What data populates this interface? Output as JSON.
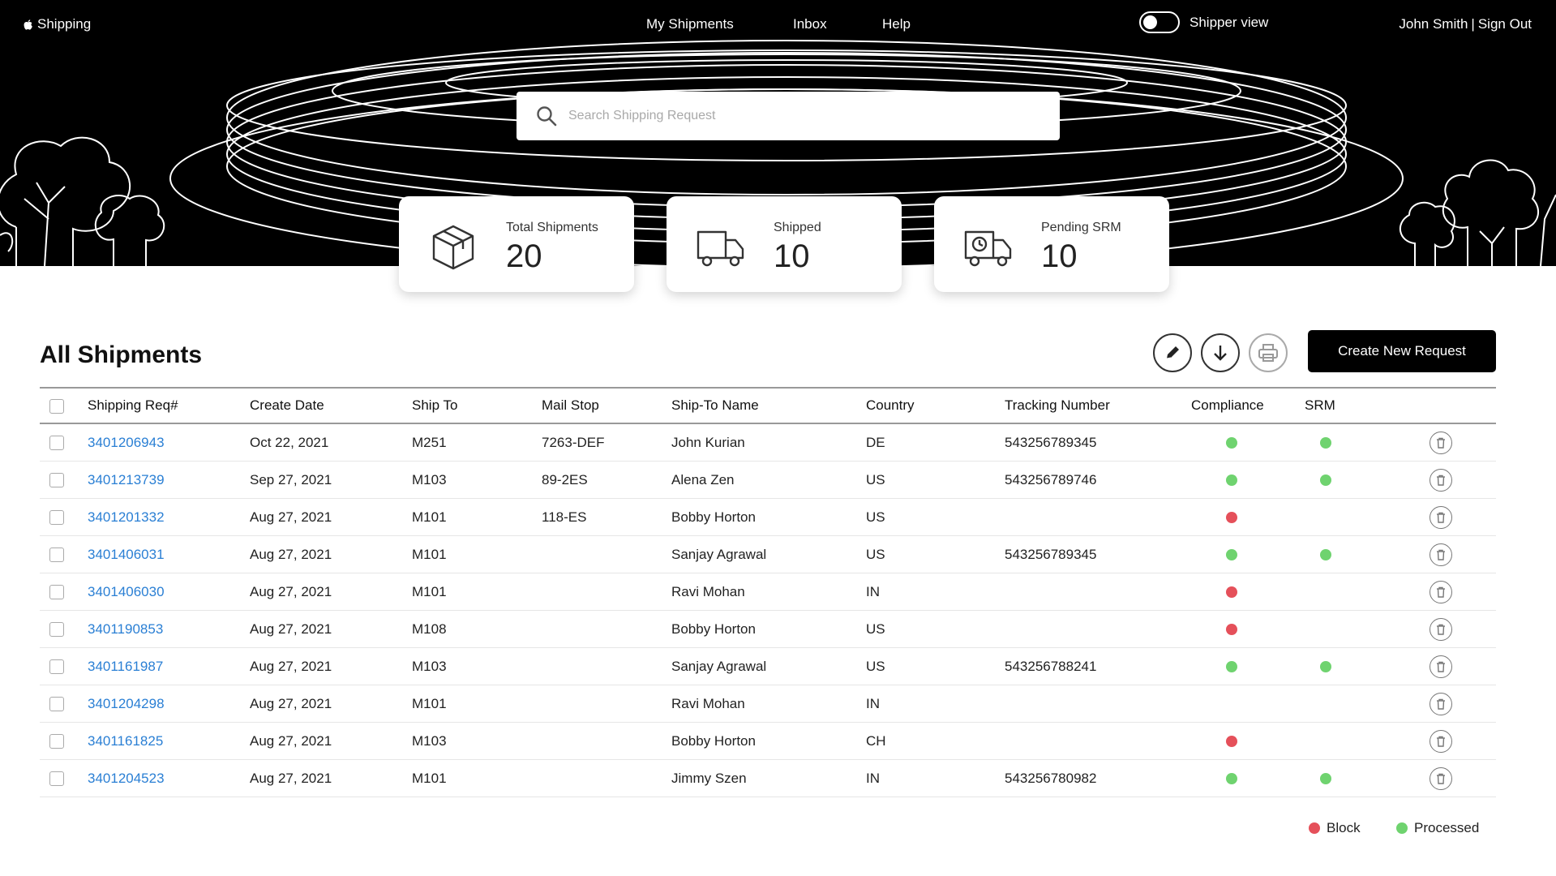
{
  "app": {
    "name": "Shipping"
  },
  "nav": {
    "items": [
      "My Shipments",
      "Inbox",
      "Help"
    ]
  },
  "toggle": {
    "label": "Shipper view",
    "on": false
  },
  "user": {
    "name": "John Smith",
    "separator": "|",
    "sign_out": "Sign Out"
  },
  "search": {
    "placeholder": "Search Shipping Request",
    "value": ""
  },
  "stats": [
    {
      "label": "Total Shipments",
      "value": "20",
      "icon": "package-icon"
    },
    {
      "label": "Shipped",
      "value": "10",
      "icon": "truck-icon"
    },
    {
      "label": "Pending SRM",
      "value": "10",
      "icon": "truck-clock-icon"
    }
  ],
  "section": {
    "title": "All Shipments"
  },
  "toolbar": {
    "edit_icon": "pencil-icon",
    "download_icon": "download-icon",
    "print_icon": "printer-icon",
    "create_label": "Create New Request"
  },
  "table": {
    "columns": [
      "Shipping Req#",
      "Create Date",
      "Ship To",
      "Mail Stop",
      "Ship-To Name",
      "Country",
      "Tracking Number",
      "Compliance",
      "SRM"
    ],
    "rows": [
      {
        "req": "3401206943",
        "date": "Oct 22, 2021",
        "ship_to": "M251",
        "mail_stop": "7263-DEF",
        "name": "John Kurian",
        "country": "DE",
        "tracking": "543256789345",
        "compliance": "processed",
        "srm": "processed"
      },
      {
        "req": "3401213739",
        "date": "Sep 27, 2021",
        "ship_to": "M103",
        "mail_stop": "89-2ES",
        "name": "Alena Zen",
        "country": "US",
        "tracking": "543256789746",
        "compliance": "processed",
        "srm": "processed"
      },
      {
        "req": "3401201332",
        "date": "Aug 27, 2021",
        "ship_to": "M101",
        "mail_stop": "118-ES",
        "name": "Bobby Horton",
        "country": "US",
        "tracking": "",
        "compliance": "block",
        "srm": ""
      },
      {
        "req": "3401406031",
        "date": "Aug 27, 2021",
        "ship_to": "M101",
        "mail_stop": "",
        "name": "Sanjay Agrawal",
        "country": "US",
        "tracking": "543256789345",
        "compliance": "processed",
        "srm": "processed"
      },
      {
        "req": "3401406030",
        "date": "Aug 27, 2021",
        "ship_to": "M101",
        "mail_stop": "",
        "name": "Ravi Mohan",
        "country": "IN",
        "tracking": "",
        "compliance": "block",
        "srm": ""
      },
      {
        "req": "3401190853",
        "date": "Aug 27, 2021",
        "ship_to": "M108",
        "mail_stop": "",
        "name": "Bobby Horton",
        "country": "US",
        "tracking": "",
        "compliance": "block",
        "srm": ""
      },
      {
        "req": "3401161987",
        "date": "Aug 27, 2021",
        "ship_to": "M103",
        "mail_stop": "",
        "name": "Sanjay Agrawal",
        "country": "US",
        "tracking": "543256788241",
        "compliance": "processed",
        "srm": "processed"
      },
      {
        "req": "3401204298",
        "date": "Aug 27, 2021",
        "ship_to": "M101",
        "mail_stop": "",
        "name": "Ravi Mohan",
        "country": "IN",
        "tracking": "",
        "compliance": "",
        "srm": ""
      },
      {
        "req": "3401161825",
        "date": "Aug 27, 2021",
        "ship_to": "M103",
        "mail_stop": "",
        "name": "Bobby Horton",
        "country": "CH",
        "tracking": "",
        "compliance": "block",
        "srm": ""
      },
      {
        "req": "3401204523",
        "date": "Aug 27, 2021",
        "ship_to": "M101",
        "mail_stop": "",
        "name": "Jimmy Szen",
        "country": "IN",
        "tracking": "543256780982",
        "compliance": "processed",
        "srm": "processed"
      }
    ],
    "row_action_icon": "delete-icon"
  },
  "legend": [
    {
      "label": "Block",
      "status": "block"
    },
    {
      "label": "Processed",
      "status": "processed"
    }
  ],
  "colors": {
    "block": "#e5505a",
    "processed": "#6fd36f",
    "link": "#2a7fd4",
    "primary_button": "#000000"
  }
}
